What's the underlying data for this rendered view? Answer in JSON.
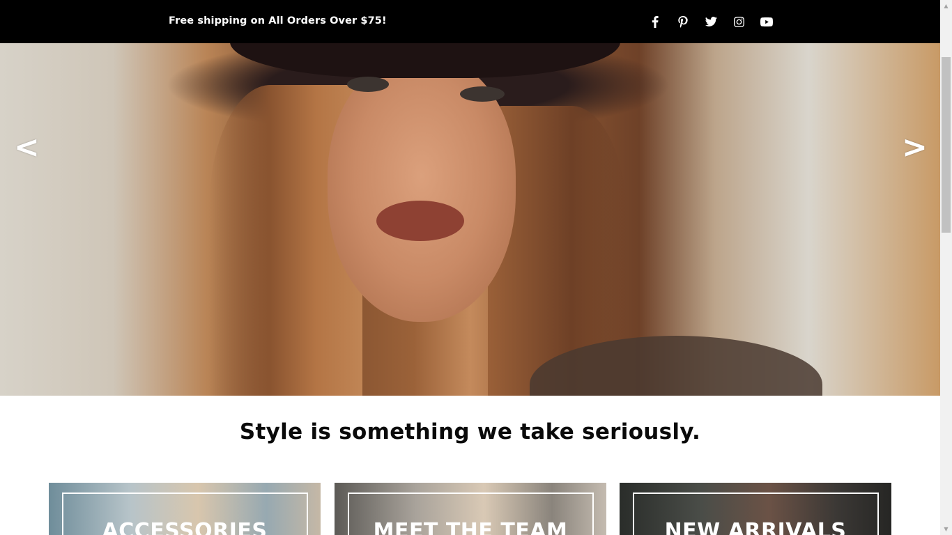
{
  "announcement": {
    "text": "Free shipping on All Orders Over $75!"
  },
  "social": [
    "facebook-icon",
    "pinterest-icon",
    "twitter-icon",
    "instagram-icon",
    "youtube-icon"
  ],
  "slider": {
    "prev_label": "<",
    "next_label": ">"
  },
  "headline": "Style is something we take seriously.",
  "cards": [
    {
      "label": "ACCESSORIES"
    },
    {
      "label": "MEET THE TEAM"
    },
    {
      "label": "NEW ARRIVALS"
    }
  ],
  "colors": {
    "topbar": "#000000",
    "text_dark": "#0a0a0a",
    "white": "#ffffff"
  }
}
